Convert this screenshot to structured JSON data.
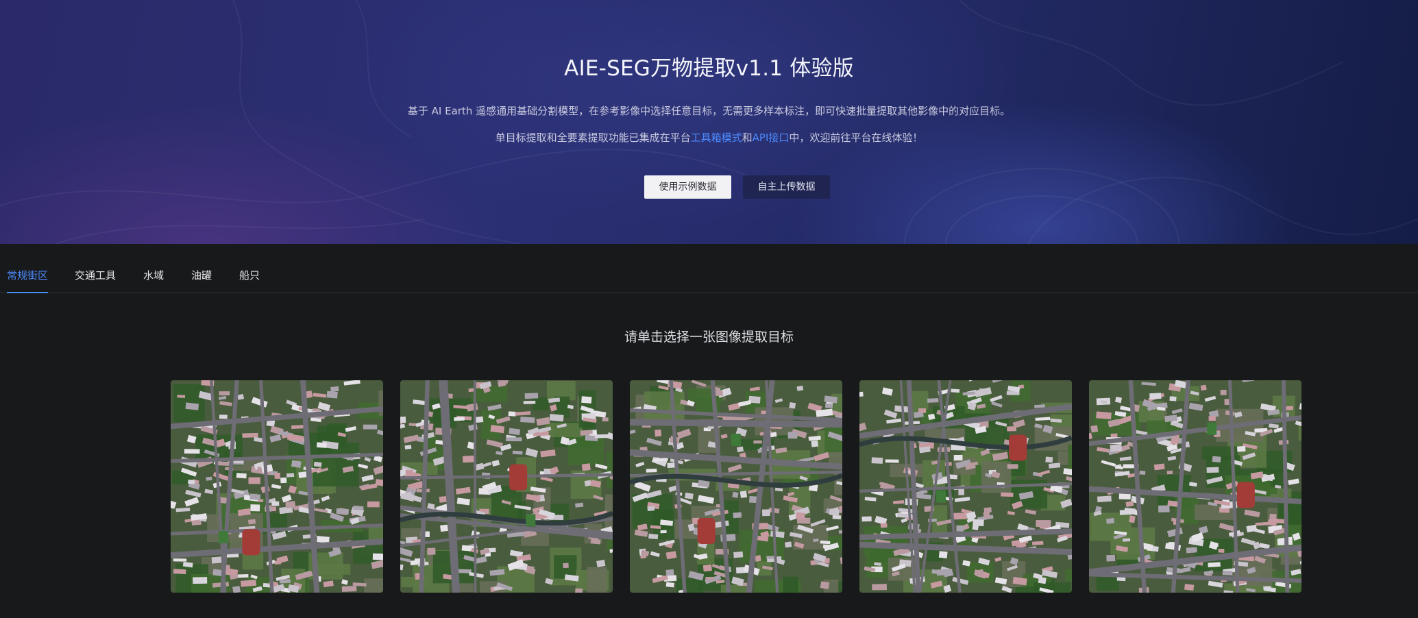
{
  "hero": {
    "title": "AIE-SEG万物提取v1.1 体验版",
    "desc_line1": "基于 AI Earth 遥感通用基础分割模型，在参考影像中选择任意目标，无需更多样本标注，即可快速批量提取其他影像中的对应目标。",
    "desc_line2_pre": "单目标提取和全要素提取功能已集成在平台",
    "desc_line2_link1": "工具箱模式",
    "desc_line2_mid": "和",
    "desc_line2_link2": "API接口",
    "desc_line2_post": "中，欢迎前往平台在线体验！",
    "button_sample": "使用示例数据",
    "button_upload": "自主上传数据"
  },
  "tabs": [
    {
      "label": "常规街区",
      "active": true
    },
    {
      "label": "交通工具",
      "active": false
    },
    {
      "label": "水域",
      "active": false
    },
    {
      "label": "油罐",
      "active": false
    },
    {
      "label": "船只",
      "active": false
    }
  ],
  "gallery": {
    "prompt": "请单击选择一张图像提取目标",
    "images": [
      {
        "name": "satellite-image-1"
      },
      {
        "name": "satellite-image-2"
      },
      {
        "name": "satellite-image-3"
      },
      {
        "name": "satellite-image-4"
      },
      {
        "name": "satellite-image-5"
      }
    ]
  },
  "colors": {
    "accent": "#4d8cff",
    "page_bg": "#18191b",
    "hero_bg": "#2a2c6e"
  }
}
